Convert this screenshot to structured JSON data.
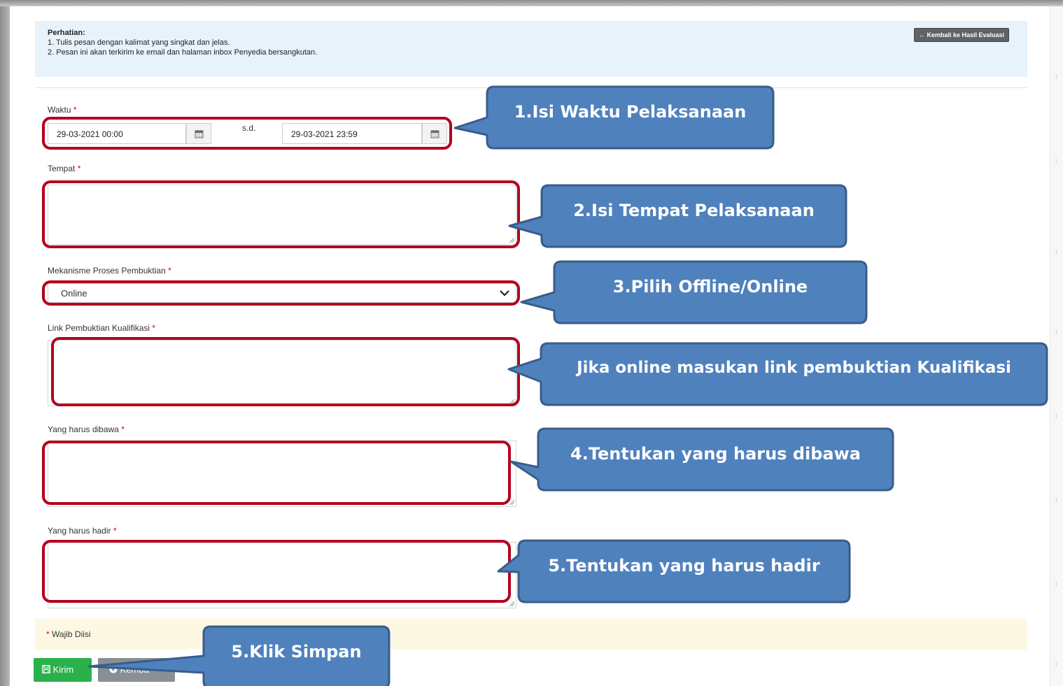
{
  "notice": {
    "title": "Perhatian:",
    "line1": "1. Tulis pesan dengan kalimat yang singkat dan jelas.",
    "line2": "2. Pesan ini akan terkirim ke email dan halaman inbox Penyedia bersangkutan.",
    "back_label": "← Kembali ke Hasil Evaluasi"
  },
  "form": {
    "waktu_label": "Waktu",
    "waktu_start": "29-03-2021 00:00",
    "sd_label": "s.d.",
    "waktu_end": "29-03-2021 23:59",
    "tempat_label": "Tempat",
    "mekanisme_label": "Mekanisme Proses Pembuktian",
    "mekanisme_value": "Online",
    "link_label": "Link Pembuktian Kualifikasi",
    "dibawa_label": "Yang harus dibawa",
    "hadir_label": "Yang harus hadir",
    "required_mark": "*",
    "wajib_note": "Wajib Diisi"
  },
  "buttons": {
    "kirim": "Kirim",
    "kembali": "Kemba"
  },
  "callouts": {
    "c1": "1.Isi Waktu Pelaksanaan",
    "c2": "2.Isi Tempat Pelaksanaan",
    "c3": "3.Pilih Offline/Online",
    "c4": "Jika online masukan link pembuktian Kualifikasi",
    "c5": "4.Tentukan yang harus dibawa",
    "c6": "5.Tentukan yang harus hadir",
    "c7": "5.Klik Simpan"
  },
  "colors": {
    "callout_fill": "#4f81bd",
    "callout_border": "#385d8a",
    "highlight": "#b3001f",
    "kirim_button": "#2ab14b",
    "kembali_button": "#8a8f94",
    "notice_bg": "#e8f2fb",
    "wajib_bg": "#fcf8e3"
  },
  "icons": {
    "calendar": "calendar-icon",
    "chevron": "chevron-down-icon",
    "save": "save-icon",
    "back": "back-circle-icon"
  }
}
